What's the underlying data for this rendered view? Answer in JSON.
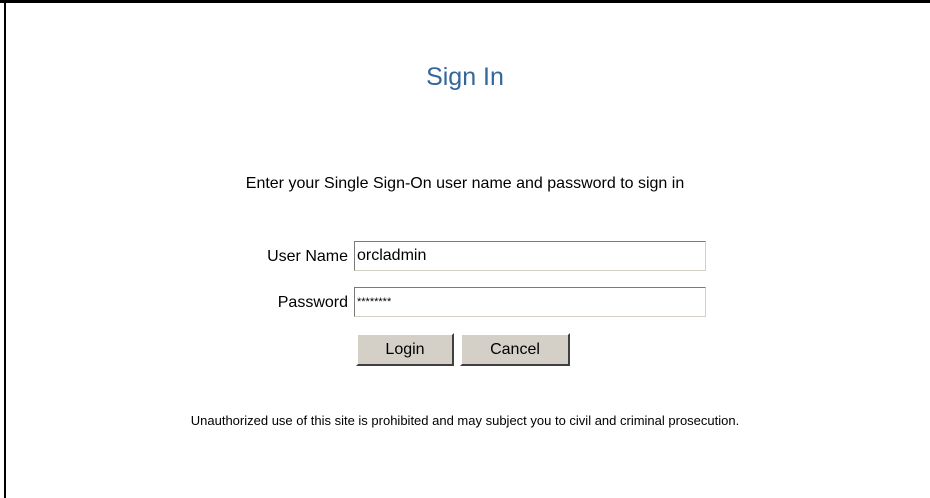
{
  "page": {
    "title": "Sign In",
    "instruction": "Enter your Single Sign-On user name and password to sign in",
    "disclaimer": "Unauthorized use of this site is prohibited and may subject you to civil and criminal prosecution."
  },
  "form": {
    "username_label": "User Name",
    "username_value": "orcladmin",
    "password_label": "Password",
    "password_value": "********",
    "login_label": "Login",
    "cancel_label": "Cancel"
  },
  "colors": {
    "title": "#336699",
    "button_face": "#d4d0c8"
  }
}
